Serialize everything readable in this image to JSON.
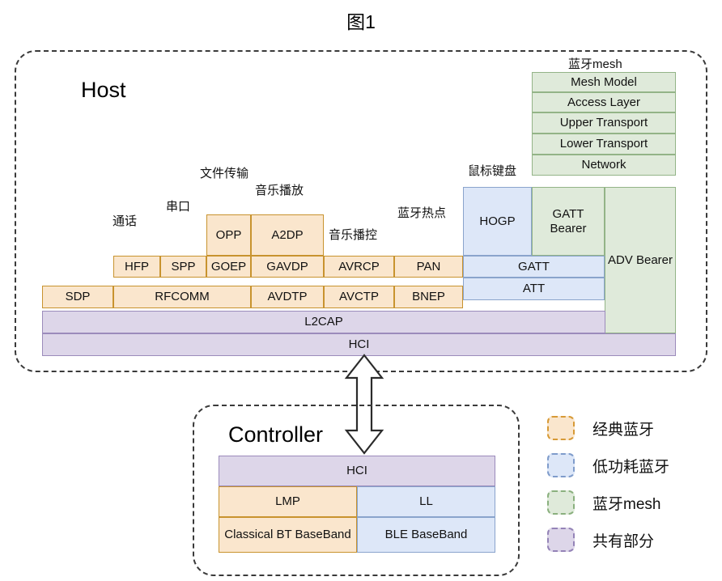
{
  "figure": {
    "title": "图1"
  },
  "host": {
    "label": "Host",
    "annotations": {
      "call": "通话",
      "serial": "串口",
      "file_transfer": "文件传输",
      "music_play": "音乐播放",
      "music_control": "音乐播控",
      "bt_hotspot": "蓝牙热点",
      "mouse_keyboard": "鼠标键盘",
      "bt_mesh": "蓝牙mesh"
    },
    "classic": {
      "row_top": [
        {
          "label": "OPP"
        },
        {
          "label": "A2DP"
        }
      ],
      "row_mid": [
        {
          "label": "HFP"
        },
        {
          "label": "SPP"
        },
        {
          "label": "GOEP"
        },
        {
          "label": "GAVDP"
        },
        {
          "label": "AVRCP"
        },
        {
          "label": "PAN"
        }
      ],
      "row_bottom": [
        {
          "label": "SDP"
        },
        {
          "label": "RFCOMM"
        },
        {
          "label": "AVDTP"
        },
        {
          "label": "AVCTP"
        },
        {
          "label": "BNEP"
        }
      ]
    },
    "ble": {
      "hogp": "HOGP",
      "gatt": "GATT",
      "att": "ATT"
    },
    "mesh": {
      "layers": [
        "Mesh Model",
        "Access Layer",
        "Upper Transport",
        "Lower Transport",
        "Network"
      ],
      "gatt_bearer": "GATT Bearer",
      "adv_bearer": "ADV Bearer"
    },
    "shared": {
      "l2cap": "L2CAP",
      "hci": "HCI"
    }
  },
  "controller": {
    "label": "Controller",
    "hci": "HCI",
    "lmp": "LMP",
    "ll": "LL",
    "classical_baseband": "Classical BT BaseBand",
    "ble_baseband": "BLE BaseBand"
  },
  "legend": {
    "items": [
      {
        "label": "经典蓝牙",
        "color": "#fae6cd"
      },
      {
        "label": "低功耗蓝牙",
        "color": "#dde7f8"
      },
      {
        "label": "蓝牙mesh",
        "color": "#dfeada"
      },
      {
        "label": "共有部分",
        "color": "#ddd6e9"
      }
    ]
  }
}
